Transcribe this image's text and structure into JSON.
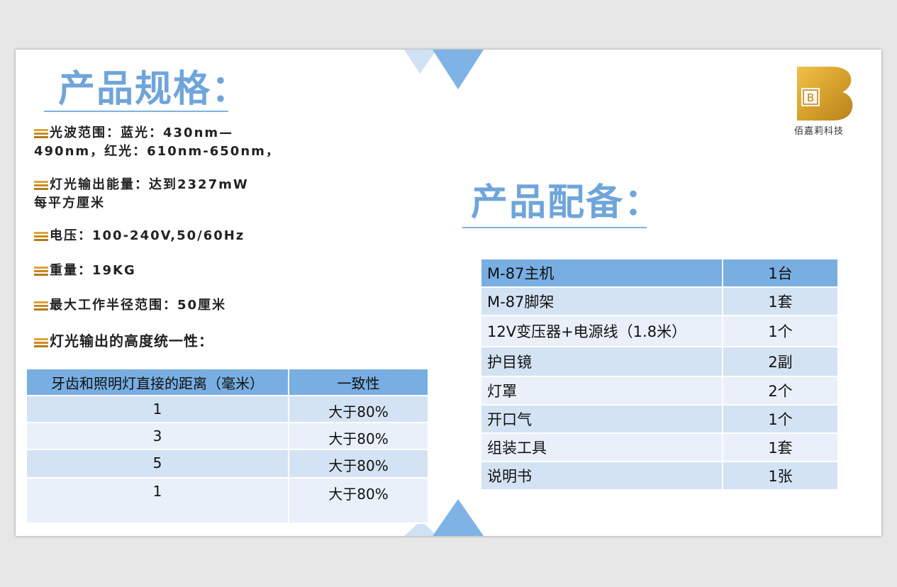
{
  "specs": {
    "title": "产品规格：",
    "items": [
      {
        "line1": "光波范围：蓝光：430nm—",
        "line2": "490nm，红光：610nm-650nm，"
      },
      {
        "line1": "灯光输出能量：达到2327mW",
        "line2": "每平方厘米"
      },
      {
        "line1": "电压：100-240V,50/60Hz",
        "line2": ""
      },
      {
        "line1": "重量：19KG",
        "line2": ""
      },
      {
        "line1": "最大工作半径范围：50厘米",
        "line2": ""
      }
    ],
    "uniformity_heading": "灯光输出的高度统一性："
  },
  "height_table": {
    "headers": [
      "牙齿和照明灯直接的距离（毫米）",
      "一致性"
    ],
    "rows": [
      [
        "1",
        "大于80%"
      ],
      [
        "3",
        "大于80%"
      ],
      [
        "5",
        "大于80%"
      ],
      [
        "1",
        "大于80%"
      ]
    ]
  },
  "accessories": {
    "title": "产品配备：",
    "rows": [
      [
        "M-87主机",
        "1台"
      ],
      [
        "M-87脚架",
        "1套"
      ],
      [
        "12V变压器+电源线（1.8米）",
        "1个"
      ],
      [
        "护目镜",
        "2副"
      ],
      [
        "灯罩",
        "2个"
      ],
      [
        "开口气",
        "1个"
      ],
      [
        "组装工具",
        "1套"
      ],
      [
        "说明书",
        "1张"
      ]
    ]
  },
  "logo": {
    "mark": "B",
    "company": "佰嘉莉科技"
  },
  "colors": {
    "accent": "#6fa5da",
    "header_fill": "#78aee2",
    "row_dark": "#d4e3f3",
    "row_light": "#e9f0f9",
    "logo_gold": "#d6a12c"
  }
}
